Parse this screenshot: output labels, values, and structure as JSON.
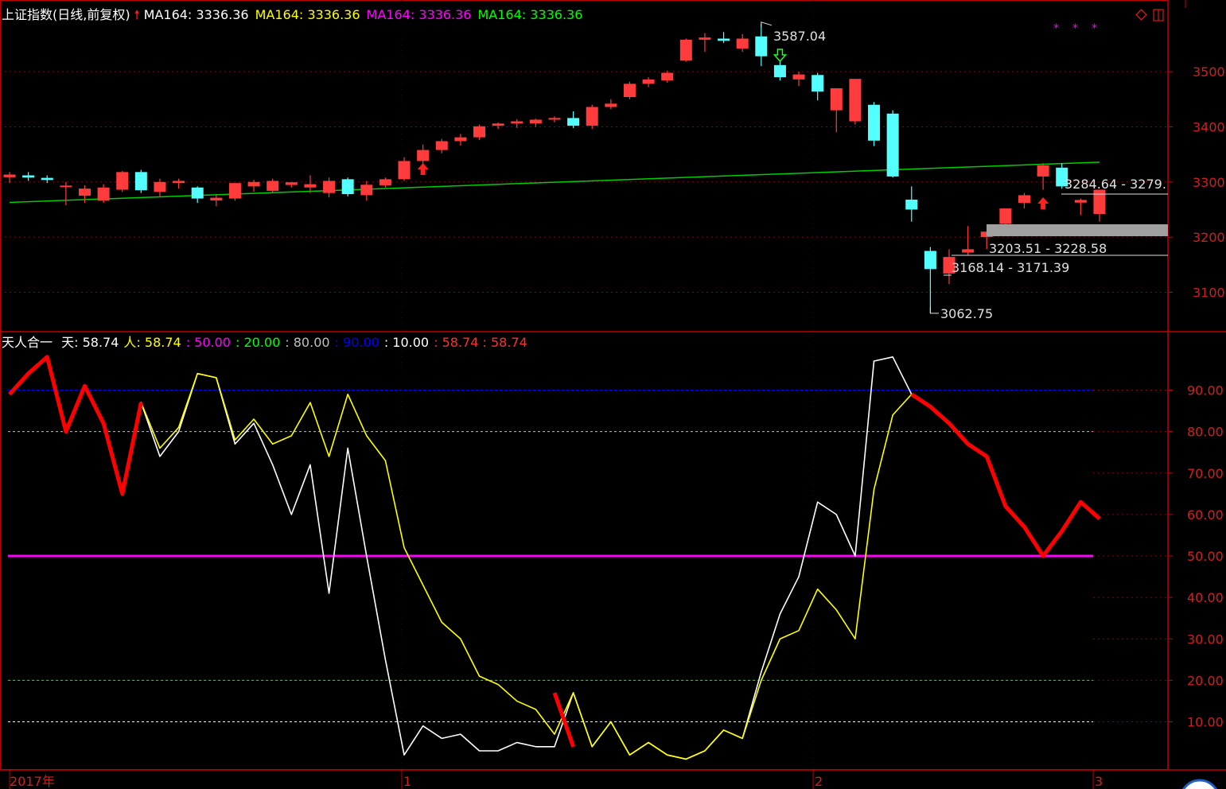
{
  "header": {
    "title": "上证指数(日线,前复权)",
    "ma_items": [
      {
        "label": "MA164: 3336.36",
        "color": "#ffffff"
      },
      {
        "label": "MA164: 3336.36",
        "color": "#ffff00"
      },
      {
        "label": "MA164: 3336.36",
        "color": "#ff00ff"
      },
      {
        "label": "MA164: 3336.36",
        "color": "#00ff00"
      }
    ]
  },
  "indicator_header": {
    "name": "天人合一",
    "items": [
      {
        "label": "天: 58.74",
        "color": "#ffffff"
      },
      {
        "label": "人: 58.74",
        "color": "#ffff00"
      },
      {
        "label": ": 50.00",
        "color": "#ff00ff"
      },
      {
        "label": ": 20.00",
        "color": "#00ff00"
      },
      {
        "label": ": 80.00",
        "color": "#c0c0c0"
      },
      {
        "label": ": 90.00",
        "color": "#0000ff"
      },
      {
        "label": ": 10.00",
        "color": "#ffffff"
      },
      {
        "label": ": 58.74 : 58.74",
        "color": "#ff3030"
      }
    ]
  },
  "colors": {
    "up": "#ff3b3b",
    "down": "#54ffff",
    "ma": "#00cc00",
    "grid": "#8b0000",
    "axis": "#c00000"
  },
  "chart_data": [
    {
      "type": "candlestick",
      "title": "上证指数(日线,前复权)",
      "ylim": [
        3030,
        3630
      ],
      "yticks": [
        3100,
        3200,
        3300,
        3400,
        3500
      ],
      "candles": [
        [
          3310,
          3318,
          3298,
          3312
        ],
        [
          3312,
          3318,
          3302,
          3308
        ],
        [
          3306,
          3312,
          3298,
          3305
        ],
        [
          3292,
          3300,
          3258,
          3292
        ],
        [
          3275,
          3294,
          3262,
          3288
        ],
        [
          3266,
          3296,
          3262,
          3290
        ],
        [
          3286,
          3320,
          3282,
          3318
        ],
        [
          3318,
          3322,
          3280,
          3285
        ],
        [
          3282,
          3306,
          3274,
          3300
        ],
        [
          3298,
          3306,
          3288,
          3302
        ],
        [
          3290,
          3292,
          3262,
          3270
        ],
        [
          3268,
          3278,
          3256,
          3270
        ],
        [
          3270,
          3298,
          3266,
          3298
        ],
        [
          3292,
          3304,
          3282,
          3300
        ],
        [
          3284,
          3306,
          3280,
          3302
        ],
        [
          3296,
          3300,
          3290,
          3298
        ],
        [
          3290,
          3312,
          3280,
          3296
        ],
        [
          3280,
          3308,
          3272,
          3302
        ],
        [
          3305,
          3308,
          3274,
          3278
        ],
        [
          3276,
          3302,
          3266,
          3295
        ],
        [
          3294,
          3308,
          3290,
          3305
        ],
        [
          3305,
          3345,
          3302,
          3338
        ],
        [
          3338,
          3368,
          3332,
          3358
        ],
        [
          3358,
          3378,
          3352,
          3374
        ],
        [
          3374,
          3387,
          3366,
          3381
        ],
        [
          3381,
          3404,
          3376,
          3401
        ],
        [
          3402,
          3408,
          3396,
          3406
        ],
        [
          3406,
          3414,
          3398,
          3410
        ],
        [
          3406,
          3415,
          3400,
          3413
        ],
        [
          3413,
          3419,
          3408,
          3416
        ],
        [
          3416,
          3428,
          3398,
          3402
        ],
        [
          3402,
          3440,
          3396,
          3436
        ],
        [
          3436,
          3450,
          3432,
          3442
        ],
        [
          3454,
          3482,
          3450,
          3478
        ],
        [
          3478,
          3490,
          3472,
          3486
        ],
        [
          3484,
          3502,
          3480,
          3498
        ],
        [
          3520,
          3560,
          3518,
          3558
        ],
        [
          3558,
          3570,
          3536,
          3562
        ],
        [
          3560,
          3572,
          3552,
          3556
        ],
        [
          3542,
          3568,
          3536,
          3560
        ],
        [
          3564,
          3587,
          3510,
          3528
        ],
        [
          3512,
          3518,
          3484,
          3490
        ],
        [
          3486,
          3500,
          3474,
          3495
        ],
        [
          3494,
          3498,
          3448,
          3464
        ],
        [
          3430,
          3462,
          3390,
          3470
        ],
        [
          3410,
          3480,
          3404,
          3487
        ],
        [
          3440,
          3445,
          3365,
          3375
        ],
        [
          3424,
          3430,
          3308,
          3310
        ],
        [
          3268,
          3292,
          3228,
          3250
        ],
        [
          3175,
          3182,
          3062,
          3142
        ],
        [
          3134,
          3178,
          3115,
          3164
        ],
        [
          3172,
          3220,
          3168,
          3178
        ],
        [
          3200,
          3205,
          3178,
          3210
        ],
        [
          3224,
          3252,
          3216,
          3252
        ],
        [
          3262,
          3280,
          3252,
          3276
        ],
        [
          3310,
          3334,
          3286,
          3330
        ],
        [
          3326,
          3334,
          3288,
          3292
        ],
        [
          3264,
          3270,
          3240,
          3266
        ],
        [
          3242,
          3285,
          3228,
          3286
        ]
      ],
      "ma_line": {
        "name": "MA164",
        "values": [
          3263,
          3336
        ]
      },
      "annotations": [
        {
          "text": "3587.04",
          "kind": "high"
        },
        {
          "text": "3062.75",
          "kind": "low"
        },
        {
          "text": "3168.14 - 3171.39",
          "kind": "gap"
        },
        {
          "text": "3203.51 - 3228.58",
          "kind": "gap"
        },
        {
          "text": "3284.64 - 3279.",
          "kind": "gap"
        }
      ]
    },
    {
      "type": "line",
      "title": "天人合一",
      "ylim": [
        0,
        100
      ],
      "yticks": [
        10,
        20,
        30,
        40,
        50,
        60,
        70,
        80,
        90
      ],
      "ytick_labels": [
        "10.00",
        "20.00",
        "30.00",
        "40.00",
        "50.00",
        "60.00",
        "70.00",
        "80.00",
        "90.00"
      ],
      "reference_lines": [
        {
          "value": 90,
          "color": "#0000ff",
          "style": "dotted"
        },
        {
          "value": 80,
          "color": "#c0c0c0",
          "style": "dotted"
        },
        {
          "value": 50,
          "color": "#ff00ff",
          "style": "solid"
        },
        {
          "value": 20,
          "color": "#00ff00",
          "style": "dotted"
        },
        {
          "value": 10,
          "color": "#ffffff",
          "style": "dotted"
        }
      ],
      "series": [
        {
          "name": "天",
          "color": "#ffffff",
          "values": [
            89,
            94,
            98,
            80,
            91,
            82,
            65,
            87,
            74,
            80,
            94,
            93,
            77,
            82,
            72,
            60,
            72,
            41,
            76,
            50,
            25,
            2,
            9,
            6,
            7,
            3,
            3,
            5,
            4,
            4,
            17,
            4,
            10,
            2,
            5,
            2,
            1,
            3,
            8,
            6,
            22,
            36,
            45,
            63,
            60,
            50,
            97,
            98,
            89,
            86,
            82,
            77,
            74,
            62,
            57,
            50,
            56,
            63,
            59
          ]
        },
        {
          "name": "人",
          "color": "#ffff00",
          "values": [
            89,
            94,
            98,
            80,
            91,
            82,
            65,
            87,
            76,
            81,
            94,
            93,
            78,
            83,
            77,
            79,
            87,
            74,
            89,
            79,
            73,
            52,
            43,
            34,
            30,
            21,
            19,
            15,
            13,
            7,
            17,
            4,
            10,
            2,
            5,
            2,
            1,
            3,
            8,
            6,
            20,
            30,
            32,
            42,
            37,
            30,
            66,
            84,
            89,
            86,
            82,
            77,
            74,
            62,
            57,
            50,
            56,
            63,
            59
          ]
        },
        {
          "name": "",
          "color": "#ff0000",
          "values": [
            89,
            94,
            98,
            80,
            91,
            82,
            65,
            87,
            null,
            null,
            null,
            null,
            null,
            null,
            null,
            null,
            null,
            null,
            null,
            null,
            null,
            null,
            null,
            null,
            null,
            null,
            null,
            null,
            null,
            17,
            4,
            null,
            null,
            null,
            null,
            null,
            null,
            null,
            null,
            null,
            null,
            null,
            null,
            null,
            null,
            null,
            null,
            null,
            89,
            86,
            82,
            77,
            74,
            62,
            57,
            50,
            56,
            63,
            59
          ]
        }
      ]
    }
  ],
  "x_axis": {
    "labels": [
      "2017年",
      "1",
      "2",
      "3"
    ]
  }
}
